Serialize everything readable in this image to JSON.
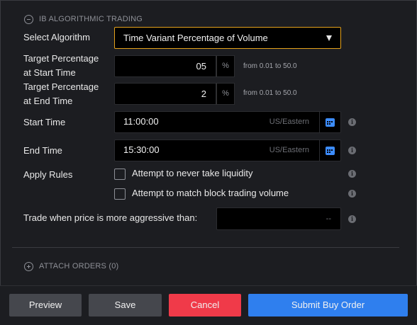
{
  "algo_section": {
    "title": "IB ALGORITHMIC TRADING"
  },
  "algorithm": {
    "label": "Select Algorithm",
    "selected": "Time Variant Percentage of Volume"
  },
  "target_start": {
    "label_line1": "Target Percentage",
    "label_line2": "at Start Time",
    "value": "05",
    "unit": "%",
    "hint": "from 0.01 to 50.0"
  },
  "target_end": {
    "label_line1": "Target Percentage",
    "label_line2": "at End Time",
    "value": "2",
    "unit": "%",
    "hint": "from 0.01 to 50.0"
  },
  "start_time": {
    "label": "Start Time",
    "value": "11:00:00",
    "timezone": "US/Eastern"
  },
  "end_time": {
    "label": "End Time",
    "value": "15:30:00",
    "timezone": "US/Eastern"
  },
  "apply_rules": {
    "label": "Apply Rules",
    "options": [
      {
        "label": "Attempt to never take liquidity",
        "checked": false
      },
      {
        "label": "Attempt to match block trading volume",
        "checked": false
      }
    ]
  },
  "aggressive": {
    "label": "Trade when price is more aggressive than:",
    "value": "--"
  },
  "attach_orders": {
    "title": "ATTACH ORDERS (0)"
  },
  "footer": {
    "preview": "Preview",
    "save": "Save",
    "cancel": "Cancel",
    "submit": "Submit Buy Order"
  },
  "colors": {
    "accent_orange": "#e5a21b",
    "cancel_red": "#f03a49",
    "submit_blue": "#2f7fee",
    "calendar_blue": "#3d8dff"
  },
  "info_icon_glyph": "i"
}
